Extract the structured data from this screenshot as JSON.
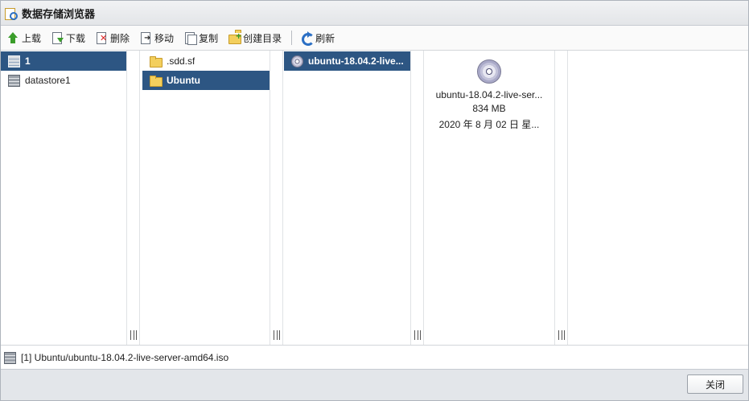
{
  "window": {
    "title": "数据存储浏览器"
  },
  "toolbar": {
    "upload": "上载",
    "download": "下载",
    "delete": "删除",
    "move": "移动",
    "copy": "复制",
    "mkdir": "创建目录",
    "refresh": "刷新"
  },
  "col1": {
    "items": [
      {
        "label": "1",
        "selected": true
      },
      {
        "label": "datastore1",
        "selected": false
      }
    ]
  },
  "col2": {
    "items": [
      {
        "label": ".sdd.sf",
        "selected": false
      },
      {
        "label": "Ubuntu",
        "selected": true
      }
    ]
  },
  "col3": {
    "items": [
      {
        "label": "ubuntu-18.04.2-live...",
        "selected": true
      }
    ]
  },
  "preview": {
    "name": "ubuntu-18.04.2-live-ser...",
    "size": "834 MB",
    "date": "2020 年 8 月 02 日 星..."
  },
  "pathbar": {
    "path": "[1] Ubuntu/ubuntu-18.04.2-live-server-amd64.iso"
  },
  "footer": {
    "close": "关闭"
  }
}
